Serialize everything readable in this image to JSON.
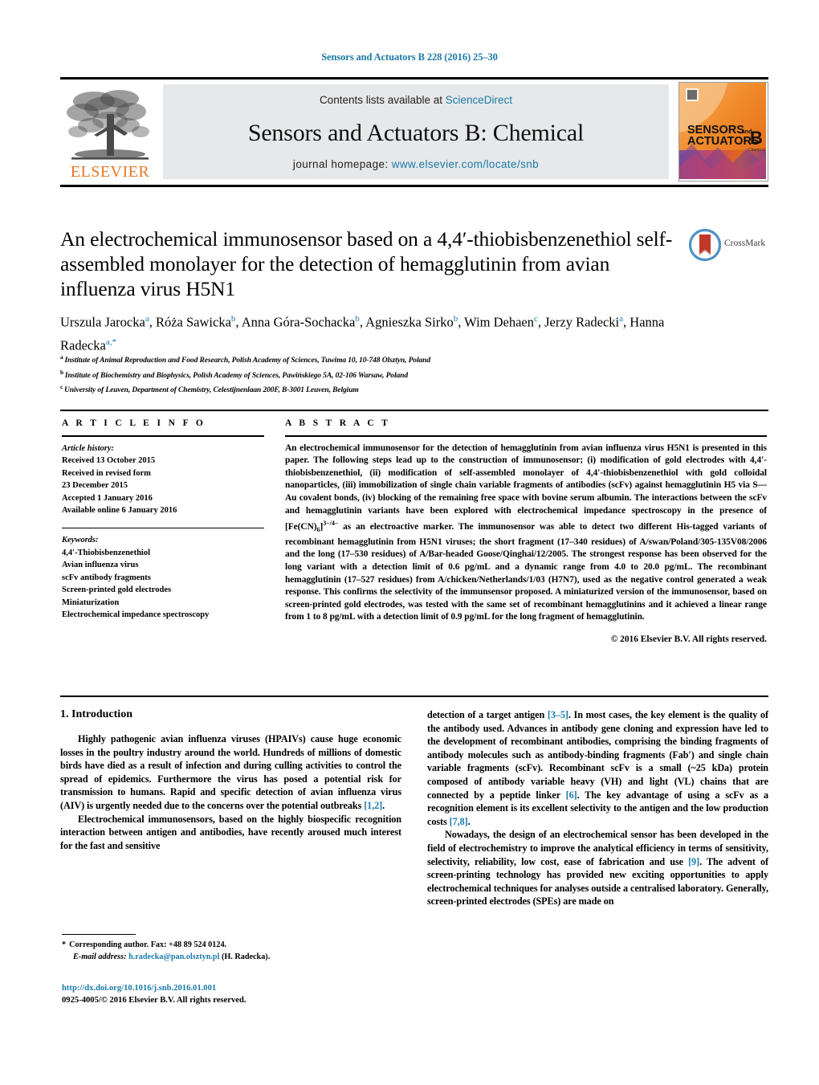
{
  "running_head": "Sensors and Actuators B 228 (2016) 25–30",
  "masthead": {
    "contents_prefix": "Contents lists available at ",
    "sciencedirect": "ScienceDirect",
    "journal_title": "Sensors and Actuators B: Chemical",
    "homepage_prefix": "journal homepage: ",
    "homepage_url": "www.elsevier.com/locate/snb",
    "publisher_name": "ELSEVIER",
    "cover_line1": "SENSORS",
    "cover_line1_small": "and",
    "cover_line2": "ACTUATORS",
    "cover_letter": "B",
    "cover_sub": "Chemical"
  },
  "crossmark": {
    "label": "CrossMark"
  },
  "title": "An electrochemical immunosensor based on a 4,4′-thiobisbenzenethiol self-assembled monolayer for the detection of hemagglutinin from avian influenza virus H5N1",
  "authors": [
    {
      "name": "Urszula Jarocka",
      "marks": "a",
      "sep": ", "
    },
    {
      "name": "Róża Sawicka",
      "marks": "b",
      "sep": ", "
    },
    {
      "name": "Anna Góra-Sochacka",
      "marks": "b",
      "sep": ", "
    },
    {
      "name": "Agnieszka Sirko",
      "marks": "b",
      "sep": ", "
    },
    {
      "name": "Wim Dehaen",
      "marks": "c",
      "sep": ", "
    },
    {
      "name": "Jerzy Radecki",
      "marks": "a",
      "sep": ", "
    },
    {
      "name": "Hanna Radecka",
      "marks": "a,*",
      "sep": ""
    }
  ],
  "affiliations": [
    {
      "mark": "a",
      "text": "Institute of Animal Reproduction and Food Research, Polish Academy of Sciences, Tuwima 10, 10-748 Olsztyn, Poland"
    },
    {
      "mark": "b",
      "text": "Institute of Biochemistry and Biophysics, Polish Academy of Sciences, Pawińskiego 5A, 02-106 Warsaw, Poland"
    },
    {
      "mark": "c",
      "text": "University of Leuven, Department of Chemistry, Celestijnenlaan 200F, B-3001 Leuven, Belgium"
    }
  ],
  "article_info": {
    "heading": "A R T I C L E    I N F O",
    "history_label": "Article history:",
    "history": [
      "Received 13 October 2015",
      "Received in revised form",
      "23 December 2015",
      "Accepted 1 January 2016",
      "Available online 6 January 2016"
    ],
    "keywords_label": "Keywords:",
    "keywords": [
      "4,4′-Thiobisbenzenethiol",
      "Avian influenza virus",
      "scFv antibody fragments",
      "Screen-printed gold electrodes",
      "Miniaturization",
      "Electrochemical impedance spectroscopy"
    ]
  },
  "abstract": {
    "heading": "A B S T R A C T",
    "p1_a": "An electrochemical immunosensor for the detection of hemagglutinin from avian influenza virus H5N1 is presented in this paper. The following steps lead up to the construction of immunosensor; (i) modification of gold electrodes with 4,4′-thiobisbenzenethiol, (ii) modification of self-assembled monolayer of 4,4′-thiobisbenzenethiol with gold colloidal nanoparticles, (iii) immobilization of single chain variable fragments of antibodies (scFv) against hemagglutinin H5 via S—Au covalent bonds, (iv) blocking of the remaining free space with bovine serum albumin. The interactions between the scFv and hemagglutinin variants have been explored with electrochemical impedance spectroscopy in the presence of [Fe(CN)",
    "p1_sub": "6",
    "p1_b": "]",
    "p1_sup": "3−/4−",
    "p1_c": " as an electroactive marker. The immunosensor was able to detect two different His-tagged variants of recombinant hemagglutinin from H5N1 viruses; the short fragment (17–340 residues) of A/swan/Poland/305-135V08/2006 and the long (17–530 residues) of A/Bar-headed Goose/Qinghai/12/2005. The strongest response has been observed for the long variant with a detection limit of 0.6 pg/mL and a dynamic range from 4.0 to 20.0 pg/mL. The recombinant hemagglutinin (17–527 residues) from A/chicken/Netherlands/1/03 (H7N7), used as the negative control generated a weak response. This confirms the selectivity of the immunsensor proposed. A miniaturized version of the immunosensor, based on screen-printed gold electrodes, was tested with the same set of recombinant hemagglutinins and it achieved a linear range from 1 to 8 pg/mL with a detection limit of 0.9 pg/mL for the long fragment of hemagglutinin.",
    "copyright": "© 2016 Elsevier B.V. All rights reserved."
  },
  "introduction": {
    "section_title": "1.  Introduction",
    "left_p1_a": "Highly pathogenic avian influenza viruses (HPAIVs) cause huge economic losses in the poultry industry around the world. Hundreds of millions of domestic birds have died as a result of infection and during culling activities to control the spread of epidemics. Furthermore the virus has posed a potential risk for transmission to humans. Rapid and specific detection of avian influenza virus (AIV) is urgently needed due to the concerns over the potential outbreaks ",
    "left_p1_ref": "[1,2]",
    "left_p1_b": ".",
    "left_p2": "Electrochemical immunosensors, based on the highly biospecific recognition interaction between antigen and antibodies, have recently aroused much interest for the fast and sensitive",
    "right_p1_a": "detection of a target antigen ",
    "right_p1_ref1": "[3–5]",
    "right_p1_b": ". In most cases, the key element is the quality of the antibody used. Advances in antibody gene cloning and expression have led to the development of recombinant antibodies, comprising the binding fragments of antibody molecules such as antibody-binding fragments (Fab′) and single chain variable fragments (scFv). Recombinant scFv is a small (~25 kDa) protein composed of antibody variable heavy (VH) and light (VL) chains that are connected by a peptide linker ",
    "right_p1_ref2": "[6]",
    "right_p1_c": ". The key advantage of using a scFv as a recognition element is its excellent selectivity to the antigen and the low production costs ",
    "right_p1_ref3": "[7,8]",
    "right_p1_d": ".",
    "right_p2_a": "Nowadays, the design of an electrochemical sensor has been developed in the field of electrochemistry to improve the analytical efficiency in terms of sensitivity, selectivity, reliability, low cost, ease of fabrication and use ",
    "right_p2_ref": "[9]",
    "right_p2_b": ". The advent of screen-printing technology has provided new exciting opportunities to apply electrochemical techniques for analyses outside a centralised laboratory. Generally, screen-printed electrodes (SPEs) are made on"
  },
  "footer": {
    "corresponding_star": "*",
    "corresponding_text": "Corresponding author. Fax: +48 89 524 0124.",
    "email_label": "E-mail address:",
    "email": "h.radecka@pan.olsztyn.pl",
    "email_suffix": "(H. Radecka).",
    "doi": "http://dx.doi.org/10.1016/j.snb.2016.01.001",
    "issn_line_a": "0925-4005/",
    "issn_line_b": "© 2016 Elsevier B.V. All rights reserved."
  },
  "colors": {
    "link_blue": "#1a7aa8",
    "elsevier_orange": "#E87722",
    "banner_gray": "#e7e8e9"
  }
}
